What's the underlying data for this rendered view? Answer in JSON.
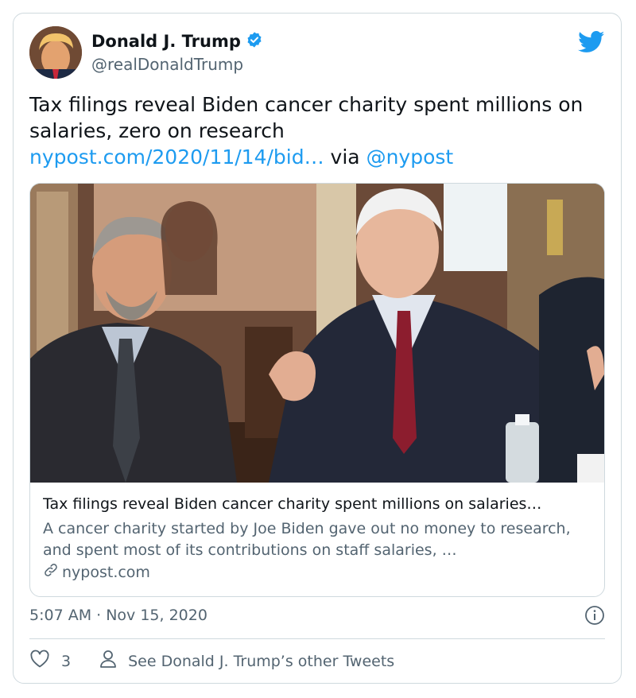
{
  "author": {
    "name": "Donald J. Trump",
    "handle": "@realDonaldTrump",
    "verified": true
  },
  "tweet": {
    "text": "Tax filings reveal Biden cancer charity spent millions on salaries, zero on research",
    "link": "nypost.com/2020/11/14/bid…",
    "via_word": "via",
    "via_handle": "@nypost"
  },
  "preview": {
    "title": "Tax filings reveal Biden cancer charity spent millions on salaries…",
    "description": "A cancer charity started by Joe Biden gave out no money to research, and spent most of its contributions on staff salaries, …",
    "domain": "nypost.com"
  },
  "timestamp": "5:07 AM · Nov 15, 2020",
  "actions": {
    "like_count": "3",
    "profile_link": "See Donald J. Trump’s other Tweets"
  },
  "colors": {
    "accent": "#1d9bf0",
    "secondary_text": "#536471",
    "border": "#cfd9de"
  },
  "icons": [
    "twitter-bird-icon",
    "verified-badge-icon",
    "info-icon",
    "heart-icon",
    "person-icon",
    "link-icon"
  ]
}
